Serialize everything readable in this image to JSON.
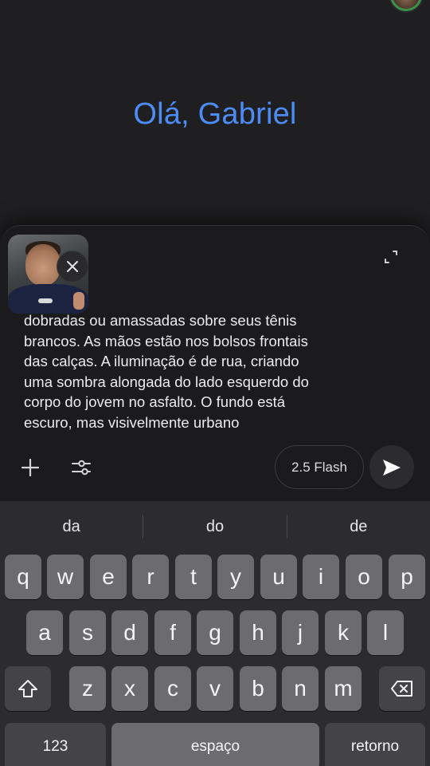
{
  "header": {
    "greeting": "Olá, Gabriel"
  },
  "composer": {
    "text_lines": [
      "dobradas ou amassadas sobre seus tênis",
      "brancos. As mãos estão nos bolsos frontais",
      "das calças. A iluminação é de rua, criando",
      "uma sombra alongada do lado esquerdo do",
      "corpo do jovem no asfalto. O fundo está",
      "escuro, mas visivelmente urbano"
    ],
    "model_label": "2.5 Flash",
    "icons": {
      "remove": "close-icon",
      "expand": "expand-icon",
      "add": "plus-icon",
      "tools": "sliders-icon",
      "send": "send-icon"
    }
  },
  "keyboard": {
    "suggestions": [
      "da",
      "do",
      "de"
    ],
    "row1": [
      "q",
      "w",
      "e",
      "r",
      "t",
      "y",
      "u",
      "i",
      "o",
      "p"
    ],
    "row2": [
      "a",
      "s",
      "d",
      "f",
      "g",
      "h",
      "j",
      "k",
      "l"
    ],
    "row3": [
      "z",
      "x",
      "c",
      "v",
      "b",
      "n",
      "m"
    ],
    "numbers_label": "123",
    "space_label": "espaço",
    "return_label": "retorno"
  },
  "colors": {
    "accent": "#4d8cf5",
    "background": "#1f1f21",
    "keyboard": "#2c2c2e",
    "key": "#6c6c70",
    "key_dark": "#444447"
  }
}
